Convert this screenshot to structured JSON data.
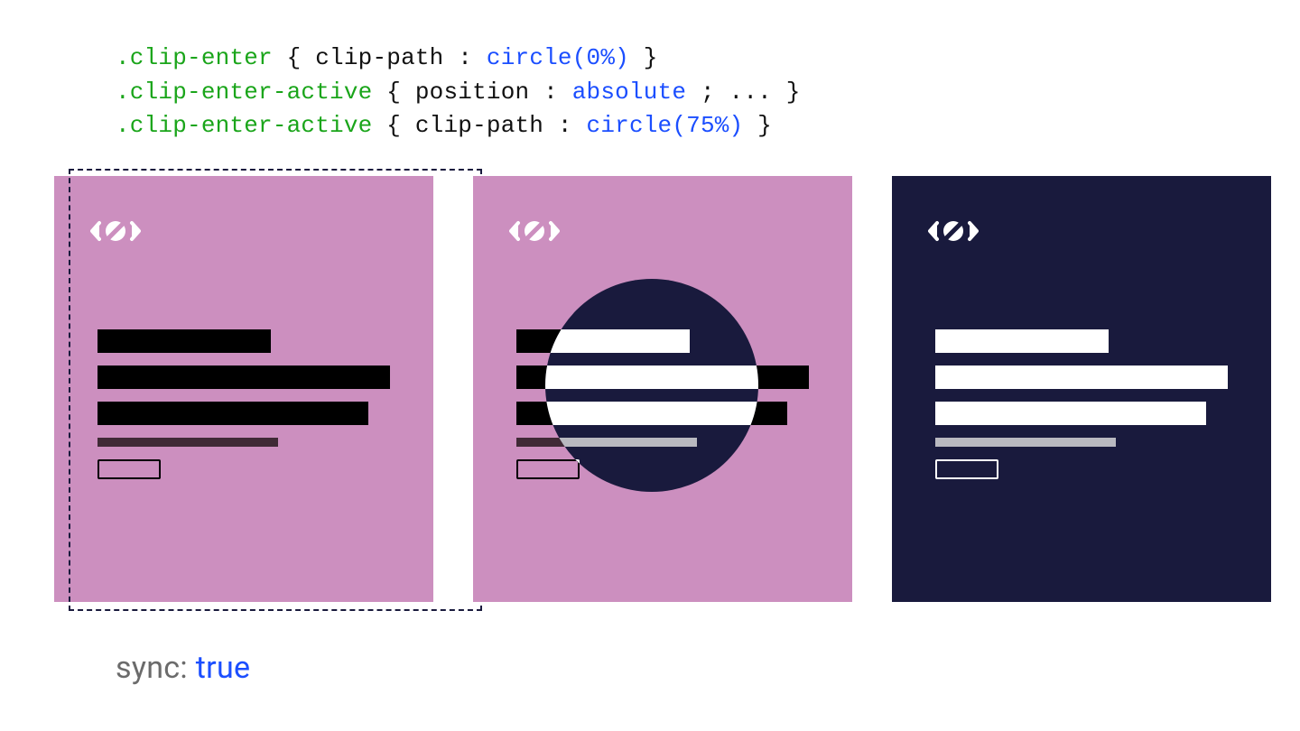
{
  "code": {
    "lines": [
      {
        "selector": ".clip-enter",
        "prop": "clip-path",
        "value": "circle(0%)",
        "tail": ""
      },
      {
        "selector": ".clip-enter-active",
        "prop": "position",
        "value": "absolute",
        "tail": "; ..."
      },
      {
        "selector": ".clip-enter-active",
        "prop": "clip-path",
        "value": "circle(75%)",
        "tail": ""
      }
    ]
  },
  "footer": {
    "label": "sync",
    "value": "true"
  },
  "colors": {
    "pink": "#cc8fbf",
    "dark": "#191a3d",
    "code_selector": "#1aa51a",
    "code_value": "#1b4eff"
  },
  "panels": [
    {
      "id": "frame-1-pink-with-dashed-overlay",
      "base": "pink",
      "overlay": null,
      "dashed": true
    },
    {
      "id": "frame-2-pink-with-dark-circle",
      "base": "pink",
      "overlay": "dark",
      "dashed": false
    },
    {
      "id": "frame-3-dark-final",
      "base": "dark",
      "overlay": null,
      "dashed": false
    }
  ],
  "icon": "hidden-icon"
}
